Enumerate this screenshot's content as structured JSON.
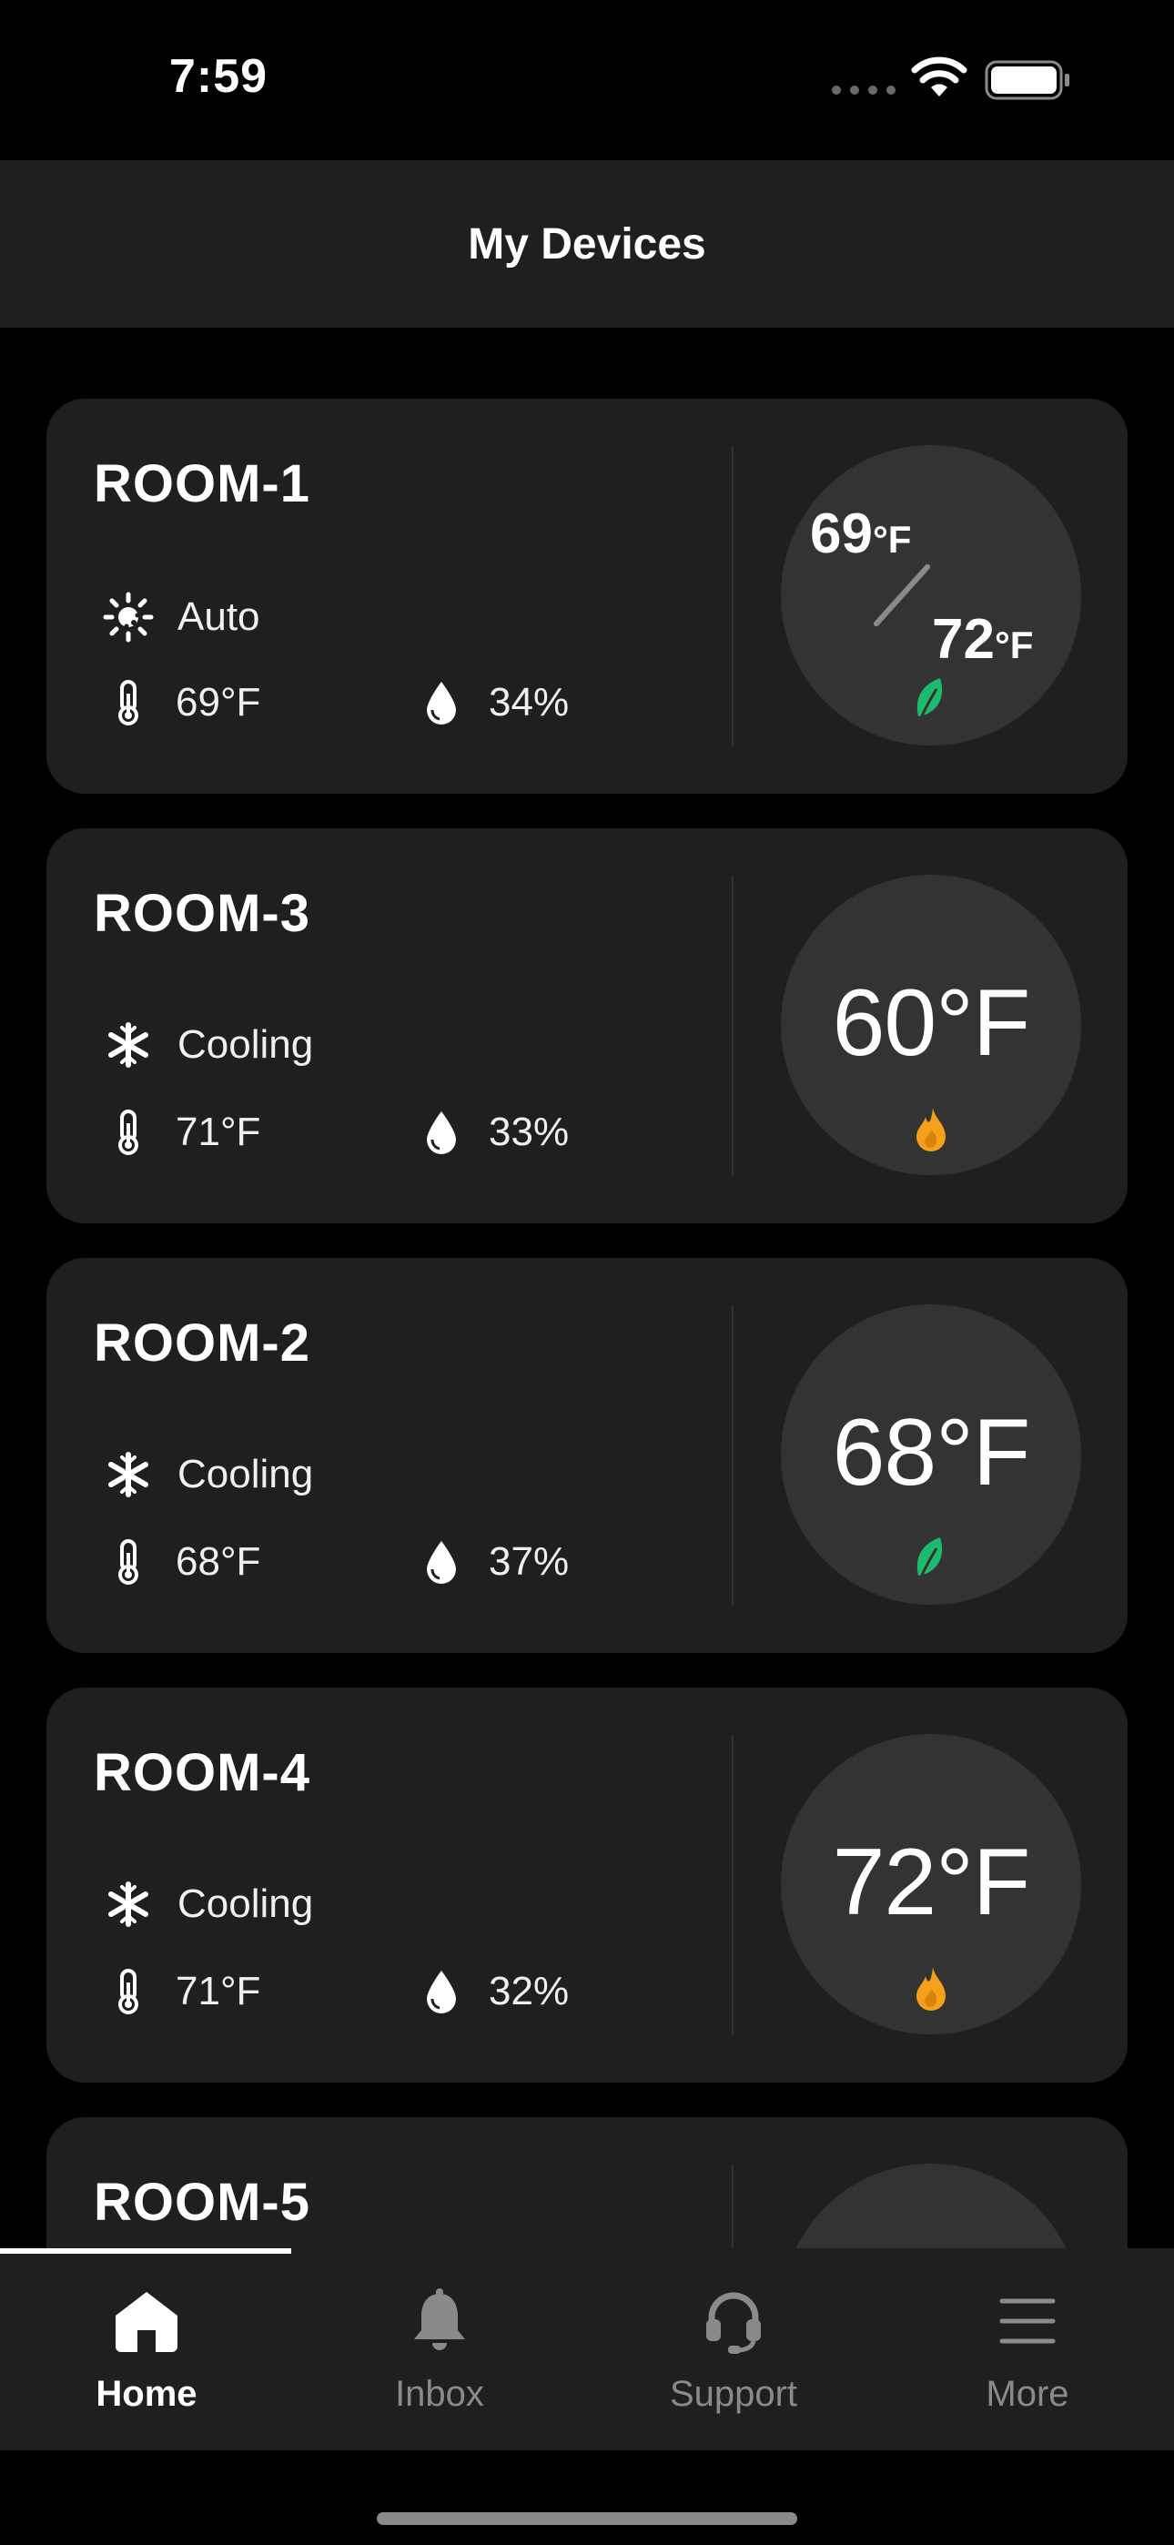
{
  "status_bar": {
    "time": "7:59"
  },
  "header": {
    "title": "My Devices"
  },
  "devices": [
    {
      "name": "ROOM-1",
      "mode": "Auto",
      "mode_icon": "auto-sun-icon",
      "indoor_temp": "69°F",
      "humidity": "34%",
      "setpoint_type": "range",
      "setpoint_low": "69",
      "setpoint_high": "72",
      "unit": "°F",
      "status_icon": "leaf-icon",
      "status_color": "#1dba6e"
    },
    {
      "name": "ROOM-3",
      "mode": "Cooling",
      "mode_icon": "snowflake-icon",
      "indoor_temp": "71°F",
      "humidity": "33%",
      "setpoint_type": "single",
      "setpoint": "60°F",
      "status_icon": "flame-icon",
      "status_color": "#f5a01a"
    },
    {
      "name": "ROOM-2",
      "mode": "Cooling",
      "mode_icon": "snowflake-icon",
      "indoor_temp": "68°F",
      "humidity": "37%",
      "setpoint_type": "single",
      "setpoint": "68°F",
      "status_icon": "leaf-icon",
      "status_color": "#1dba6e"
    },
    {
      "name": "ROOM-4",
      "mode": "Cooling",
      "mode_icon": "snowflake-icon",
      "indoor_temp": "71°F",
      "humidity": "32%",
      "setpoint_type": "single",
      "setpoint": "72°F",
      "status_icon": "flame-icon",
      "status_color": "#f5a01a"
    },
    {
      "name": "ROOM-5",
      "mode": "",
      "mode_icon": "",
      "indoor_temp": "",
      "humidity": "",
      "setpoint_type": "single",
      "setpoint": ""
    }
  ],
  "tabs": [
    {
      "label": "Home",
      "icon": "home-icon",
      "active": true
    },
    {
      "label": "Inbox",
      "icon": "bell-icon",
      "active": false
    },
    {
      "label": "Support",
      "icon": "headset-icon",
      "active": false
    },
    {
      "label": "More",
      "icon": "menu-icon",
      "active": false
    }
  ],
  "colors": {
    "background": "#000000",
    "surface": "#1f1f1f",
    "dial": "#333333",
    "eco_green": "#1dba6e",
    "heat_orange": "#f5a01a"
  }
}
